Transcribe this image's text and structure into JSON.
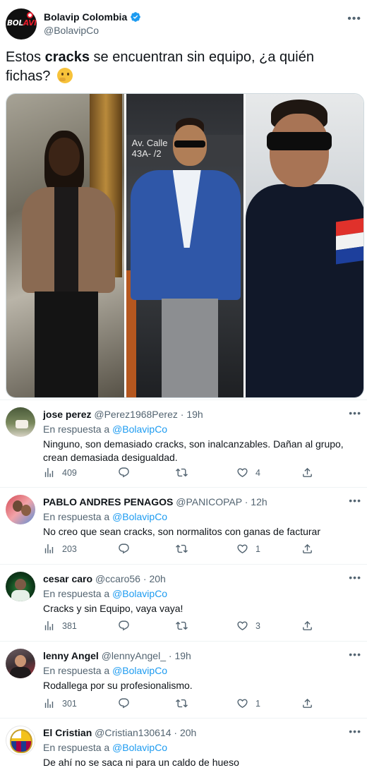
{
  "main_tweet": {
    "author_name": "Bolavip Colombia",
    "author_handle": "@BolavipCo",
    "text_before": "Estos ",
    "text_bold": "cracks",
    "text_after": " se encuentran sin equipo, ¿a quién fichas?",
    "avatar_logo_white": "BOL",
    "avatar_logo_red": "AVIP",
    "photo_sign_text": "Av. Calle\n43A- /2"
  },
  "icons": {
    "verified": "verified-badge-icon",
    "more": "more-options-icon",
    "views": "views-bar-chart-icon",
    "reply": "reply-bubble-icon",
    "retweet": "retweet-icon",
    "like": "heart-icon",
    "share": "share-upload-icon"
  },
  "colors": {
    "accent": "#1d9bf0",
    "text_primary": "#0f1419",
    "text_secondary": "#536471",
    "divider": "#eff3f4"
  },
  "reply_label": "En respuesta a",
  "replies": [
    {
      "name": "jose perez",
      "handle": "@Perez1968Perez",
      "dot": "·",
      "time": "19h",
      "in_reply_to": "@BolavipCo",
      "text": "Ninguno, son demasiado cracks, son inalcanzables. Dañan al grupo, crean demasiada desigualdad.",
      "views": "409",
      "likes": "4"
    },
    {
      "name": "PABLO ANDRES PENAGOS",
      "handle": "@PANICOPAP",
      "dot": "·",
      "time": "12h",
      "in_reply_to": "@BolavipCo",
      "text": "No creo que sean cracks, son normalitos con ganas de facturar",
      "views": "203",
      "likes": "1"
    },
    {
      "name": "cesar caro",
      "handle": "@ccaro56",
      "dot": "·",
      "time": "20h",
      "in_reply_to": "@BolavipCo",
      "text": "Cracks y sin Equipo, vaya vaya!",
      "views": "381",
      "likes": "3"
    },
    {
      "name": "lenny Angel",
      "handle": "@lennyAngel_",
      "dot": "·",
      "time": "19h",
      "in_reply_to": "@BolavipCo",
      "text": "Rodallega por su profesionalismo.",
      "views": "301",
      "likes": "1"
    },
    {
      "name": "El Cristian",
      "handle": "@Cristian130614",
      "dot": "·",
      "time": "20h",
      "in_reply_to": "@BolavipCo",
      "text": "De ahí no se saca ni para un caldo de hueso"
    }
  ]
}
